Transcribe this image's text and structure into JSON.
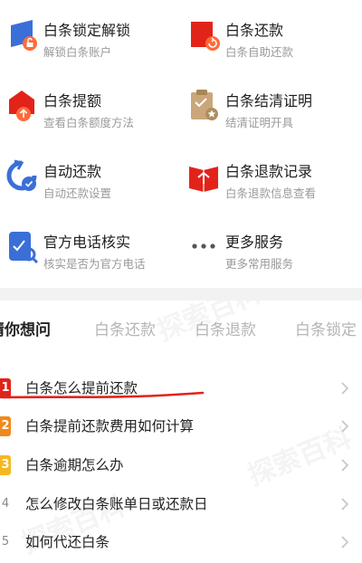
{
  "services": [
    {
      "title": "白条锁定解锁",
      "subtitle": "解锁白条账户",
      "icon": "lock-unlock-icon"
    },
    {
      "title": "白条还款",
      "subtitle": "白条自助还款",
      "icon": "repay-icon"
    },
    {
      "title": "白条提额",
      "subtitle": "查看白条额度方法",
      "icon": "raise-limit-icon"
    },
    {
      "title": "白条结清证明",
      "subtitle": "结清证明开具",
      "icon": "settlement-certificate-icon"
    },
    {
      "title": "自动还款",
      "subtitle": "自动还款设置",
      "icon": "auto-repay-icon"
    },
    {
      "title": "白条退款记录",
      "subtitle": "白条退款信息查看",
      "icon": "refund-record-icon"
    },
    {
      "title": "官方电话核实",
      "subtitle": "核实是否为官方电话",
      "icon": "phone-verify-icon"
    },
    {
      "title": "更多服务",
      "subtitle": "更多常用服务",
      "icon": "more-dots-icon"
    }
  ],
  "tabs": [
    "猜你想问",
    "白条还款",
    "白条退款",
    "白条锁定"
  ],
  "questions": [
    {
      "num": "1",
      "text": "白条怎么提前还款",
      "color": "#e2231a"
    },
    {
      "num": "2",
      "text": "白条提前还款费用如何计算",
      "color": "#f08a1c"
    },
    {
      "num": "3",
      "text": "白条逾期怎么办",
      "color": "#f5b820"
    },
    {
      "num": "4",
      "text": "怎么修改白条账单日或还款日",
      "color": ""
    },
    {
      "num": "5",
      "text": "如何代还白条",
      "color": ""
    }
  ],
  "watermark": "探索百科",
  "colors": {
    "brand_red": "#e2231a",
    "icon_blue": "#3a6fd8",
    "icon_tan": "#c9a77a",
    "arrow_gray": "#c4c4c4"
  }
}
